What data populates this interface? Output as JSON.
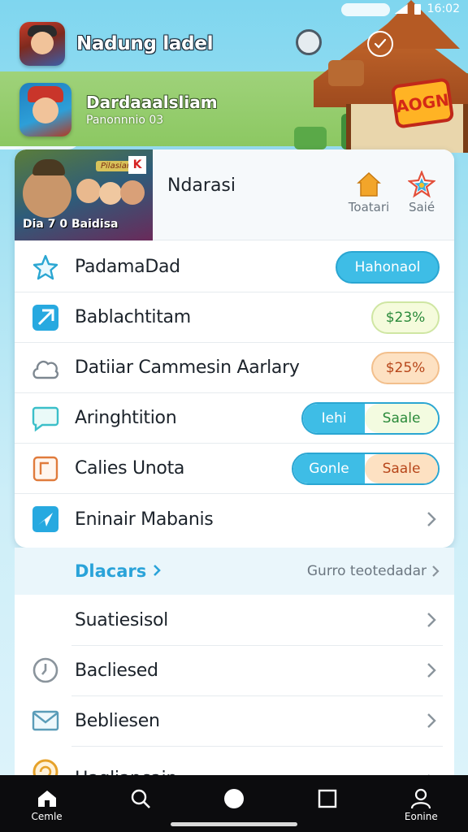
{
  "status_bar": {
    "time": "16:02"
  },
  "header": {
    "title": "Nadung ladel"
  },
  "profile": {
    "name": "Dardaaalsliam",
    "subtitle": "Panonnnio 03"
  },
  "scenery": {
    "temple_sign": "AOGN"
  },
  "game_card": {
    "thumb_label": "Dia 7 0  Baidisa",
    "thumb_tag": "Pilasians",
    "thumb_flag": "K",
    "title": "Ndarasi",
    "actions": [
      {
        "label": "Toatari",
        "icon": "home-icon",
        "color": "#f2a52a"
      },
      {
        "label": "Saié",
        "icon": "star-icon",
        "color": "#e24f3a"
      }
    ]
  },
  "rows": [
    {
      "label": "PadamaDad",
      "icon": "star-outline-icon",
      "type": "pill-blue",
      "pill": "Hahonaol"
    },
    {
      "label": "Bablachtitam",
      "icon": "send-icon",
      "type": "pill-green",
      "pill": "$23%"
    },
    {
      "label": "Datiiar Cammesin Aarlary",
      "icon": "cloud-icon",
      "type": "pill-orange",
      "pill": "$25%"
    },
    {
      "label": "Aringhtition",
      "icon": "chat-bubble-icon",
      "type": "pill-pair",
      "pill_left": "Iehi",
      "pill_right": "Saale"
    },
    {
      "label": "Calies Unota",
      "icon": "frame-icon",
      "type": "pill-pair2",
      "pill_left": "Gonle",
      "pill_right": "Saale"
    },
    {
      "label": "Eninair Mabanis",
      "icon": "send-box-icon",
      "type": "chevron"
    }
  ],
  "section": {
    "title": "Dlacars",
    "link": "Gurro teotedadar"
  },
  "list2": [
    {
      "label": "Suatiesisol",
      "icon": ""
    },
    {
      "label": "Bacliesed",
      "icon": "clock-icon"
    },
    {
      "label": "Bebliesen",
      "icon": "mail-icon"
    },
    {
      "label": "Hagliancain",
      "icon": "refresh-icon"
    }
  ],
  "bottom_nav": [
    {
      "label": "Cemle",
      "icon": "home-icon"
    },
    {
      "label": "",
      "icon": "search-icon"
    },
    {
      "label": "",
      "icon": "circle-icon"
    },
    {
      "label": "",
      "icon": "square-icon"
    },
    {
      "label": "Eonine",
      "icon": "profile-icon"
    }
  ],
  "colors": {
    "accent_blue": "#3ebde6",
    "green_pill": "#2a8a3a",
    "orange_pill": "#b7461a",
    "section_title": "#2aa3d9"
  }
}
